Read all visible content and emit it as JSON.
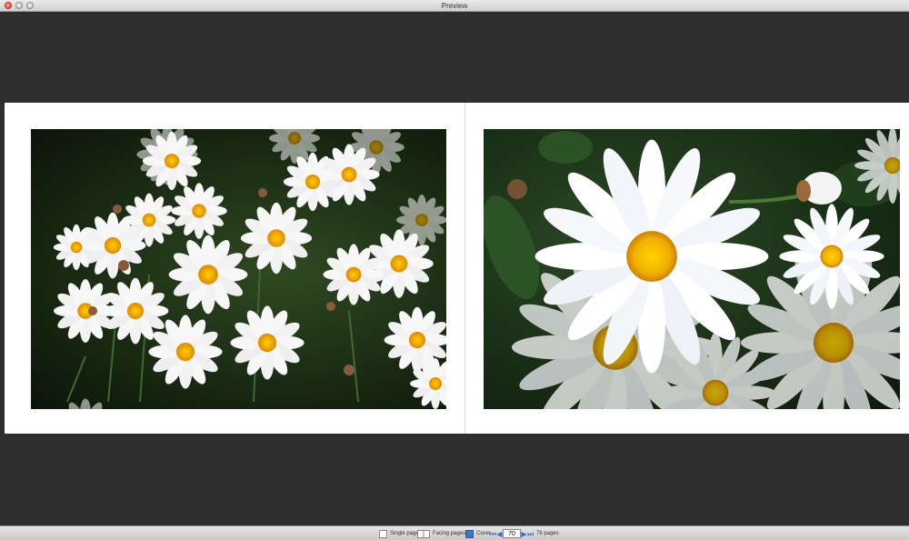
{
  "window": {
    "title": "Preview"
  },
  "toolbar": {
    "single_page_label": "Single page",
    "facing_pages_label": "Facing pages",
    "cover_label": "Cover",
    "current_page": "70",
    "total_pages_label": "76 pages",
    "icons": {
      "first": "skip-first-icon",
      "prev": "play-back-icon",
      "next": "play-forward-icon",
      "last": "skip-last-icon"
    }
  },
  "colors": {
    "background": "#2e2e2e",
    "page": "#ffffff",
    "accent": "#2f6fc4"
  }
}
